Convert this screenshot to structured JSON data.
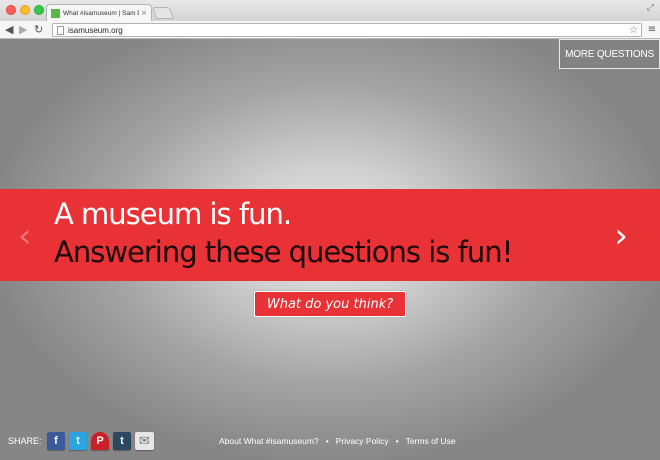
{
  "browser": {
    "tab_title": "What #isamuseum | Sam D",
    "tab_close": "×",
    "url": "isamuseum.org",
    "icons": {
      "back": "◀",
      "forward": "▶",
      "reload": "↻",
      "star": "☆",
      "menu": "≡",
      "fullscreen": "⤢"
    }
  },
  "page": {
    "more_questions": "MORE QUESTIONS",
    "statement_line1": "A museum is fun.",
    "statement_line2": "Answering these questions is fun!",
    "prev_arrow": "‹",
    "next_arrow": "›",
    "cta_label": "What do you think?",
    "colors": {
      "accent_red": "#e83236",
      "line2_text": "#1b0709"
    }
  },
  "footer": {
    "share_label": "SHARE:",
    "social": {
      "facebook": "f",
      "twitter": "t",
      "pinterest": "P",
      "tumblr": "t",
      "email": "✉"
    },
    "links": [
      "About What #isamuseum?",
      "Privacy Policy",
      "Terms of Use"
    ],
    "separator": "•"
  }
}
